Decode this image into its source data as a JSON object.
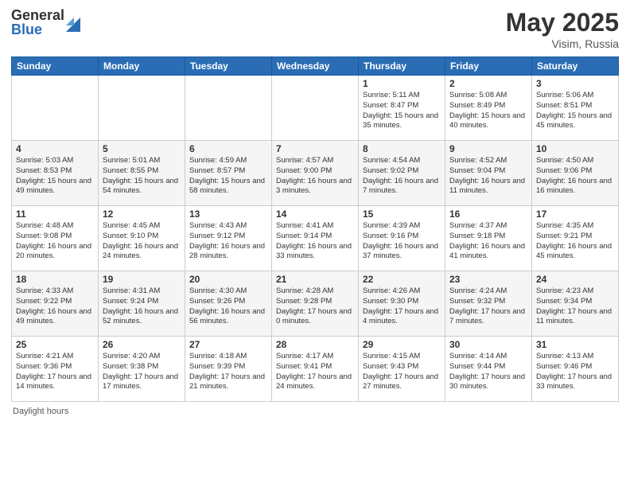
{
  "header": {
    "logo_general": "General",
    "logo_blue": "Blue",
    "title": "May 2025",
    "location": "Visim, Russia"
  },
  "columns": [
    "Sunday",
    "Monday",
    "Tuesday",
    "Wednesday",
    "Thursday",
    "Friday",
    "Saturday"
  ],
  "weeks": [
    [
      {
        "day": "",
        "info": ""
      },
      {
        "day": "",
        "info": ""
      },
      {
        "day": "",
        "info": ""
      },
      {
        "day": "",
        "info": ""
      },
      {
        "day": "1",
        "info": "Sunrise: 5:11 AM\nSunset: 8:47 PM\nDaylight: 15 hours\nand 35 minutes."
      },
      {
        "day": "2",
        "info": "Sunrise: 5:08 AM\nSunset: 8:49 PM\nDaylight: 15 hours\nand 40 minutes."
      },
      {
        "day": "3",
        "info": "Sunrise: 5:06 AM\nSunset: 8:51 PM\nDaylight: 15 hours\nand 45 minutes."
      }
    ],
    [
      {
        "day": "4",
        "info": "Sunrise: 5:03 AM\nSunset: 8:53 PM\nDaylight: 15 hours\nand 49 minutes."
      },
      {
        "day": "5",
        "info": "Sunrise: 5:01 AM\nSunset: 8:55 PM\nDaylight: 15 hours\nand 54 minutes."
      },
      {
        "day": "6",
        "info": "Sunrise: 4:59 AM\nSunset: 8:57 PM\nDaylight: 15 hours\nand 58 minutes."
      },
      {
        "day": "7",
        "info": "Sunrise: 4:57 AM\nSunset: 9:00 PM\nDaylight: 16 hours\nand 3 minutes."
      },
      {
        "day": "8",
        "info": "Sunrise: 4:54 AM\nSunset: 9:02 PM\nDaylight: 16 hours\nand 7 minutes."
      },
      {
        "day": "9",
        "info": "Sunrise: 4:52 AM\nSunset: 9:04 PM\nDaylight: 16 hours\nand 11 minutes."
      },
      {
        "day": "10",
        "info": "Sunrise: 4:50 AM\nSunset: 9:06 PM\nDaylight: 16 hours\nand 16 minutes."
      }
    ],
    [
      {
        "day": "11",
        "info": "Sunrise: 4:48 AM\nSunset: 9:08 PM\nDaylight: 16 hours\nand 20 minutes."
      },
      {
        "day": "12",
        "info": "Sunrise: 4:45 AM\nSunset: 9:10 PM\nDaylight: 16 hours\nand 24 minutes."
      },
      {
        "day": "13",
        "info": "Sunrise: 4:43 AM\nSunset: 9:12 PM\nDaylight: 16 hours\nand 28 minutes."
      },
      {
        "day": "14",
        "info": "Sunrise: 4:41 AM\nSunset: 9:14 PM\nDaylight: 16 hours\nand 33 minutes."
      },
      {
        "day": "15",
        "info": "Sunrise: 4:39 AM\nSunset: 9:16 PM\nDaylight: 16 hours\nand 37 minutes."
      },
      {
        "day": "16",
        "info": "Sunrise: 4:37 AM\nSunset: 9:18 PM\nDaylight: 16 hours\nand 41 minutes."
      },
      {
        "day": "17",
        "info": "Sunrise: 4:35 AM\nSunset: 9:21 PM\nDaylight: 16 hours\nand 45 minutes."
      }
    ],
    [
      {
        "day": "18",
        "info": "Sunrise: 4:33 AM\nSunset: 9:22 PM\nDaylight: 16 hours\nand 49 minutes."
      },
      {
        "day": "19",
        "info": "Sunrise: 4:31 AM\nSunset: 9:24 PM\nDaylight: 16 hours\nand 52 minutes."
      },
      {
        "day": "20",
        "info": "Sunrise: 4:30 AM\nSunset: 9:26 PM\nDaylight: 16 hours\nand 56 minutes."
      },
      {
        "day": "21",
        "info": "Sunrise: 4:28 AM\nSunset: 9:28 PM\nDaylight: 17 hours\nand 0 minutes."
      },
      {
        "day": "22",
        "info": "Sunrise: 4:26 AM\nSunset: 9:30 PM\nDaylight: 17 hours\nand 4 minutes."
      },
      {
        "day": "23",
        "info": "Sunrise: 4:24 AM\nSunset: 9:32 PM\nDaylight: 17 hours\nand 7 minutes."
      },
      {
        "day": "24",
        "info": "Sunrise: 4:23 AM\nSunset: 9:34 PM\nDaylight: 17 hours\nand 11 minutes."
      }
    ],
    [
      {
        "day": "25",
        "info": "Sunrise: 4:21 AM\nSunset: 9:36 PM\nDaylight: 17 hours\nand 14 minutes."
      },
      {
        "day": "26",
        "info": "Sunrise: 4:20 AM\nSunset: 9:38 PM\nDaylight: 17 hours\nand 17 minutes."
      },
      {
        "day": "27",
        "info": "Sunrise: 4:18 AM\nSunset: 9:39 PM\nDaylight: 17 hours\nand 21 minutes."
      },
      {
        "day": "28",
        "info": "Sunrise: 4:17 AM\nSunset: 9:41 PM\nDaylight: 17 hours\nand 24 minutes."
      },
      {
        "day": "29",
        "info": "Sunrise: 4:15 AM\nSunset: 9:43 PM\nDaylight: 17 hours\nand 27 minutes."
      },
      {
        "day": "30",
        "info": "Sunrise: 4:14 AM\nSunset: 9:44 PM\nDaylight: 17 hours\nand 30 minutes."
      },
      {
        "day": "31",
        "info": "Sunrise: 4:13 AM\nSunset: 9:46 PM\nDaylight: 17 hours\nand 33 minutes."
      }
    ]
  ],
  "footer": {
    "daylight_label": "Daylight hours"
  }
}
